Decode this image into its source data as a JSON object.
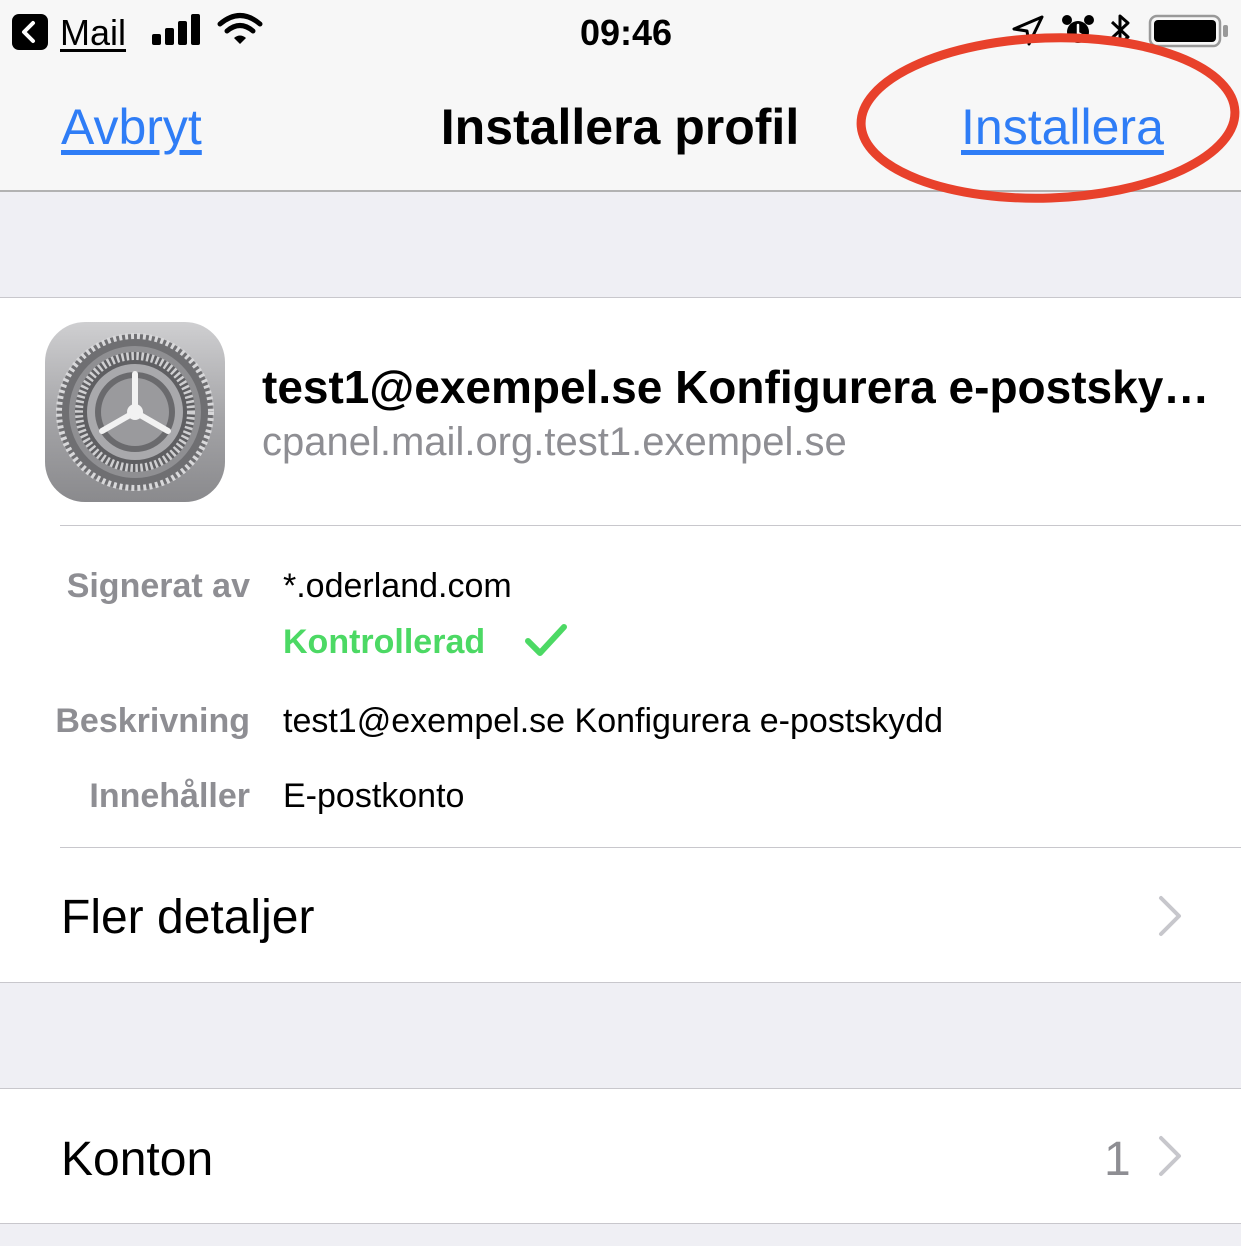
{
  "status_bar": {
    "back_app": "Mail",
    "time": "09:46"
  },
  "nav": {
    "cancel_label": "Avbryt",
    "title": "Installera profil",
    "install_label": "Installera"
  },
  "profile": {
    "icon": "settings-gear-icon",
    "name": "test1@exempel.se Konfigurera e-postskydd",
    "identifier": "cpanel.mail.org.test1.exempel.se"
  },
  "details": {
    "signed_by_label": "Signerat av",
    "signed_by_value": "*.oderland.com",
    "verified_label": "Kontrollerad",
    "description_label": "Beskrivning",
    "description_value": "test1@exempel.se Konfigurera e-postskydd",
    "contains_label": "Innehåller",
    "contains_value": "E-postkonto"
  },
  "more_details": {
    "label": "Fler detaljer"
  },
  "accounts": {
    "label": "Konton",
    "count": "1"
  },
  "colors": {
    "link_blue": "#2f7df6",
    "verified_green": "#4cd964",
    "annotation_red": "#e8412b",
    "secondary_gray": "#8e8e93"
  }
}
